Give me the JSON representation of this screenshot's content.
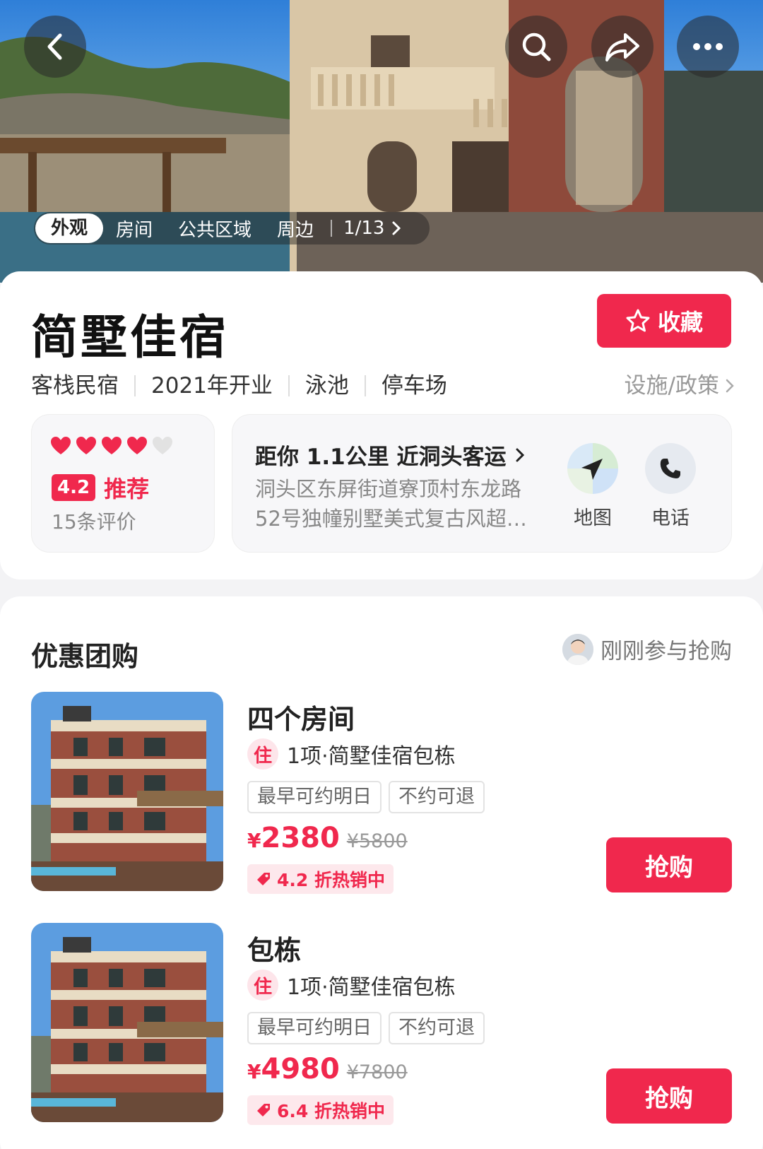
{
  "hero": {
    "photo_tabs": [
      "外观",
      "房间",
      "公共区域",
      "周边"
    ],
    "photo_counter": "1/13"
  },
  "hotel": {
    "name": "简墅佳宿",
    "favorite_label": "收藏",
    "tags": [
      "客栈民宿",
      "2021年开业",
      "泳池",
      "停车场"
    ],
    "facility_link": "设施/政策",
    "rating": {
      "hearts_filled": 4,
      "hearts_total": 5,
      "score": "4.2",
      "score_label": "推荐",
      "review_count": "15条评价"
    },
    "address": {
      "distance": "距你 1.1公里 近洞头客运",
      "text": "洞头区东屏街道寮顶村东龙路52号独幢别墅美式复古风超…",
      "map_label": "地图",
      "phone_label": "电话"
    }
  },
  "deals": {
    "title": "优惠团购",
    "recent_text": "刚刚参与抢购",
    "items": [
      {
        "name": "四个房间",
        "badge": "住",
        "item": "1项·简墅佳宿包栋",
        "tags": [
          "最早可约明日",
          "不约可退"
        ],
        "currency": "¥",
        "price": "2380",
        "original": "¥5800",
        "discount": "4.2 折热销中",
        "buy": "抢购"
      },
      {
        "name": "包栋",
        "badge": "住",
        "item": "1项·简墅佳宿包栋",
        "tags": [
          "最早可约明日",
          "不约可退"
        ],
        "currency": "¥",
        "price": "4980",
        "original": "¥7800",
        "discount": "6.4 折热销中",
        "buy": "抢购"
      }
    ]
  },
  "colors": {
    "accent": "#f0284d",
    "accent_light": "#fde8ec",
    "muted": "#999999"
  },
  "icons": [
    "back-icon",
    "search-icon",
    "share-icon",
    "more-icon",
    "star-icon",
    "chevron-right-icon",
    "heart-icon",
    "navigate-icon",
    "phone-icon",
    "price-tag-icon"
  ]
}
